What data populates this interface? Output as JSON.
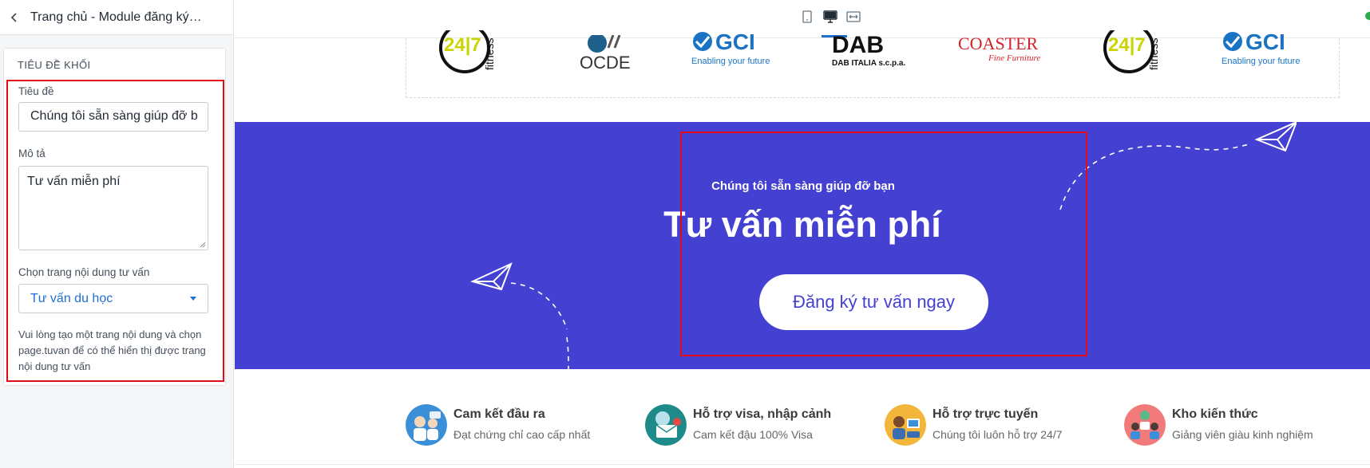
{
  "sidebar": {
    "header_title": "Trang chủ - Module đăng ký…",
    "section_title": "TIÊU ĐỀ KHỐI",
    "fields": {
      "title_label": "Tiêu đề",
      "title_value": "Chúng tôi sẵn sàng giúp đỡ b",
      "desc_label": "Mô tả",
      "desc_value": "Tư vấn miễn phí",
      "page_label": "Chọn trang nội dung tư vấn",
      "page_value": "Tư vấn du học"
    },
    "help_text": "Vui lòng tạo một trang nội dung và chọn page.tuvan để có thể hiển thị được trang nội dung tư vấn"
  },
  "topbar": {
    "devices": [
      "mobile-icon",
      "desktop-icon",
      "fullwidth-icon"
    ],
    "active_device": "desktop-icon"
  },
  "logos": [
    {
      "main": "24|7",
      "sub": "fitness"
    },
    {
      "main": "OCDE",
      "sub": ""
    },
    {
      "main": "GCI",
      "sub": "Enabling your future"
    },
    {
      "main": "DAB",
      "sub": "DAB ITALIA s.c.p.a."
    },
    {
      "main": "COASTER",
      "sub": "Fine Furniture"
    },
    {
      "main": "24|7",
      "sub": "fitness"
    },
    {
      "main": "GCI",
      "sub": "Enabling your future"
    }
  ],
  "banner": {
    "subtitle": "Chúng tôi sẵn sàng giúp đỡ bạn",
    "title": "Tư vấn miễn phí",
    "button_label": "Đăng ký tư vấn ngay",
    "bg_color": "#4440d2"
  },
  "features": [
    {
      "title": "Cam kết đầu ra",
      "desc": "Đạt chứng chỉ cao cấp nhất",
      "icon": "graduates-icon",
      "color": "#3b8fd8"
    },
    {
      "title": "Hỗ trợ visa, nhập cảnh",
      "desc": "Cam kết đậu 100% Visa",
      "icon": "visa-envelope-icon",
      "color": "#1e8a8a"
    },
    {
      "title": "Hỗ trợ trực tuyến",
      "desc": "Chúng tôi luôn hỗ trợ 24/7",
      "icon": "online-support-icon",
      "color": "#f2b63a"
    },
    {
      "title": "Kho kiến thức",
      "desc": "Giảng viên giàu kinh nghiệm",
      "icon": "knowledge-icon",
      "color": "#f27a7a"
    }
  ],
  "colors": {
    "accent": "#1e6fd4",
    "highlight": "#e30b17"
  }
}
